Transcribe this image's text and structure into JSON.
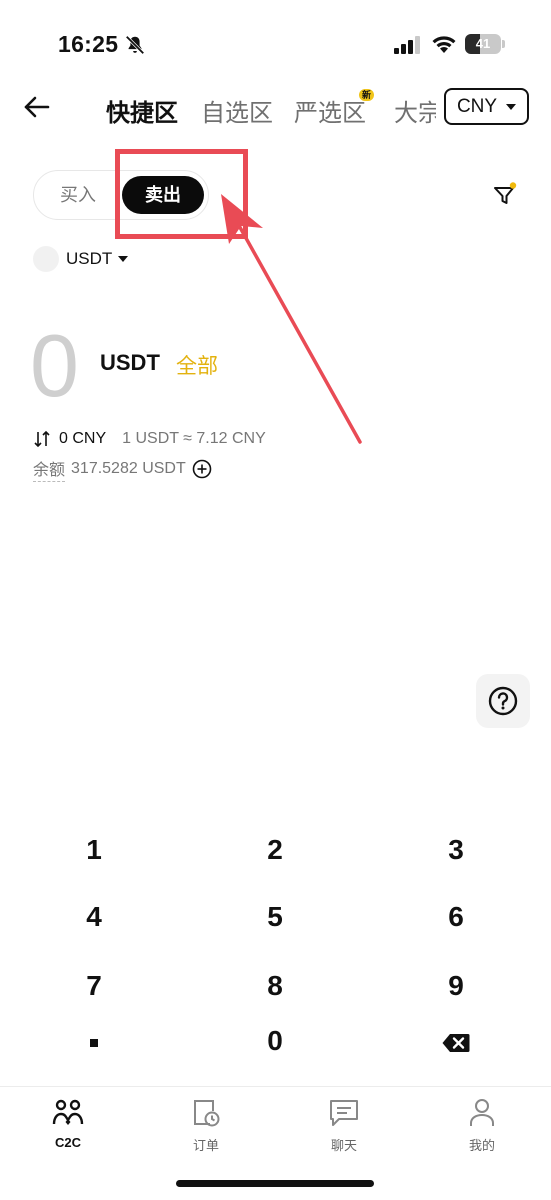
{
  "status_bar": {
    "time": "16:25",
    "battery": "41",
    "battery_level": 0.41
  },
  "header": {
    "tabs": [
      {
        "label": "快捷区",
        "active": true
      },
      {
        "label": "自选区",
        "active": false
      },
      {
        "label": "严选区",
        "active": false,
        "badge": "新"
      },
      {
        "label": "大宗",
        "active": false
      }
    ],
    "currency": "CNY"
  },
  "trade_toggle": {
    "buy": "买入",
    "sell": "卖出",
    "selected": "卖出"
  },
  "coin": {
    "symbol": "USDT"
  },
  "amount": {
    "value": "0",
    "unit": "USDT",
    "all_label": "全部",
    "converted": "0 CNY",
    "rate": "1 USDT ≈ 7.12 CNY",
    "balance_label": "余额",
    "balance_value": "317.5282 USDT"
  },
  "keypad": {
    "keys": [
      "1",
      "2",
      "3",
      "4",
      "5",
      "6",
      "7",
      "8",
      "9",
      "0"
    ]
  },
  "bottom_nav": [
    {
      "label": "C2C",
      "icon": "c2c-users-icon",
      "active": true
    },
    {
      "label": "订单",
      "icon": "orders-icon",
      "active": false
    },
    {
      "label": "聊天",
      "icon": "chat-icon",
      "active": false
    },
    {
      "label": "我的",
      "icon": "profile-icon",
      "active": false
    }
  ],
  "colors": {
    "accent_yellow": "#e3b20f",
    "annotation_red": "#e94b55",
    "selected_pill": "#0b0b0b"
  }
}
